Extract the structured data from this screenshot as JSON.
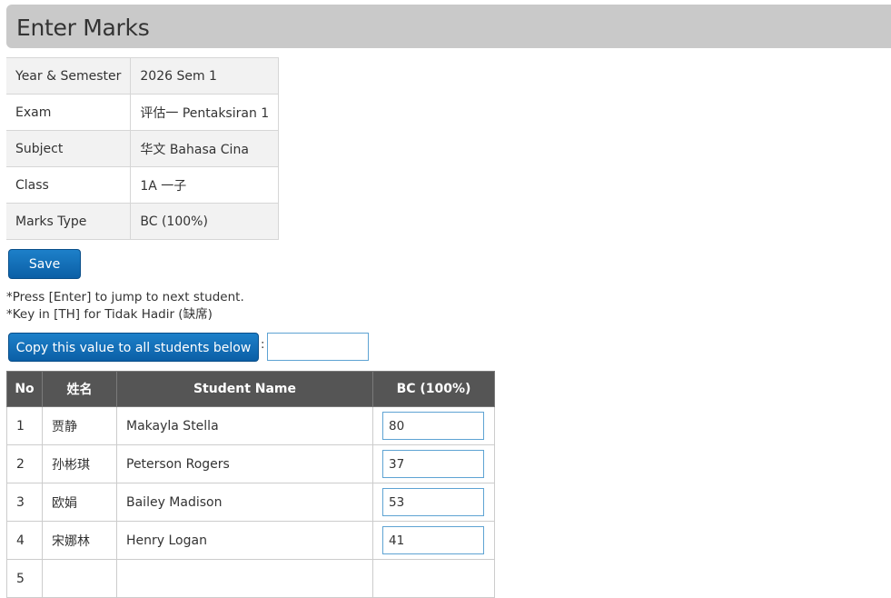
{
  "page": {
    "title": "Enter Marks"
  },
  "info": [
    {
      "label": "Year & Semester",
      "value": "2026 Sem 1"
    },
    {
      "label": "Exam",
      "value": "评估一 Pentaksiran 1"
    },
    {
      "label": "Subject",
      "value": "华文 Bahasa Cina"
    },
    {
      "label": "Class",
      "value": "1A 一子"
    },
    {
      "label": "Marks Type",
      "value": "BC (100%)"
    }
  ],
  "actions": {
    "save_label": "Save",
    "copy_label": "Copy this value to all students below",
    "copy_separator": ":",
    "copy_value": ""
  },
  "notes": [
    "*Press [Enter] to jump to next student.",
    "*Key in [TH] for Tidak Hadir (缺席)"
  ],
  "marks_table": {
    "headers": [
      "No",
      "姓名",
      "Student Name",
      "BC (100%)"
    ],
    "rows": [
      {
        "no": "1",
        "chinese_name": "贾静",
        "name": "Makayla Stella",
        "mark": "80"
      },
      {
        "no": "2",
        "chinese_name": "孙彬琪",
        "name": "Peterson Rogers",
        "mark": "37"
      },
      {
        "no": "3",
        "chinese_name": "欧娟",
        "name": "Bailey Madison",
        "mark": "53"
      },
      {
        "no": "4",
        "chinese_name": "宋娜林",
        "name": "Henry Logan",
        "mark": "41"
      },
      {
        "no": "5",
        "chinese_name": "",
        "name": "",
        "mark": ""
      }
    ]
  },
  "colors": {
    "title_bar": "#c9c9c9",
    "primary_button": "#0b5fa6",
    "table_header": "#555555",
    "input_border": "#5ea3d3"
  }
}
